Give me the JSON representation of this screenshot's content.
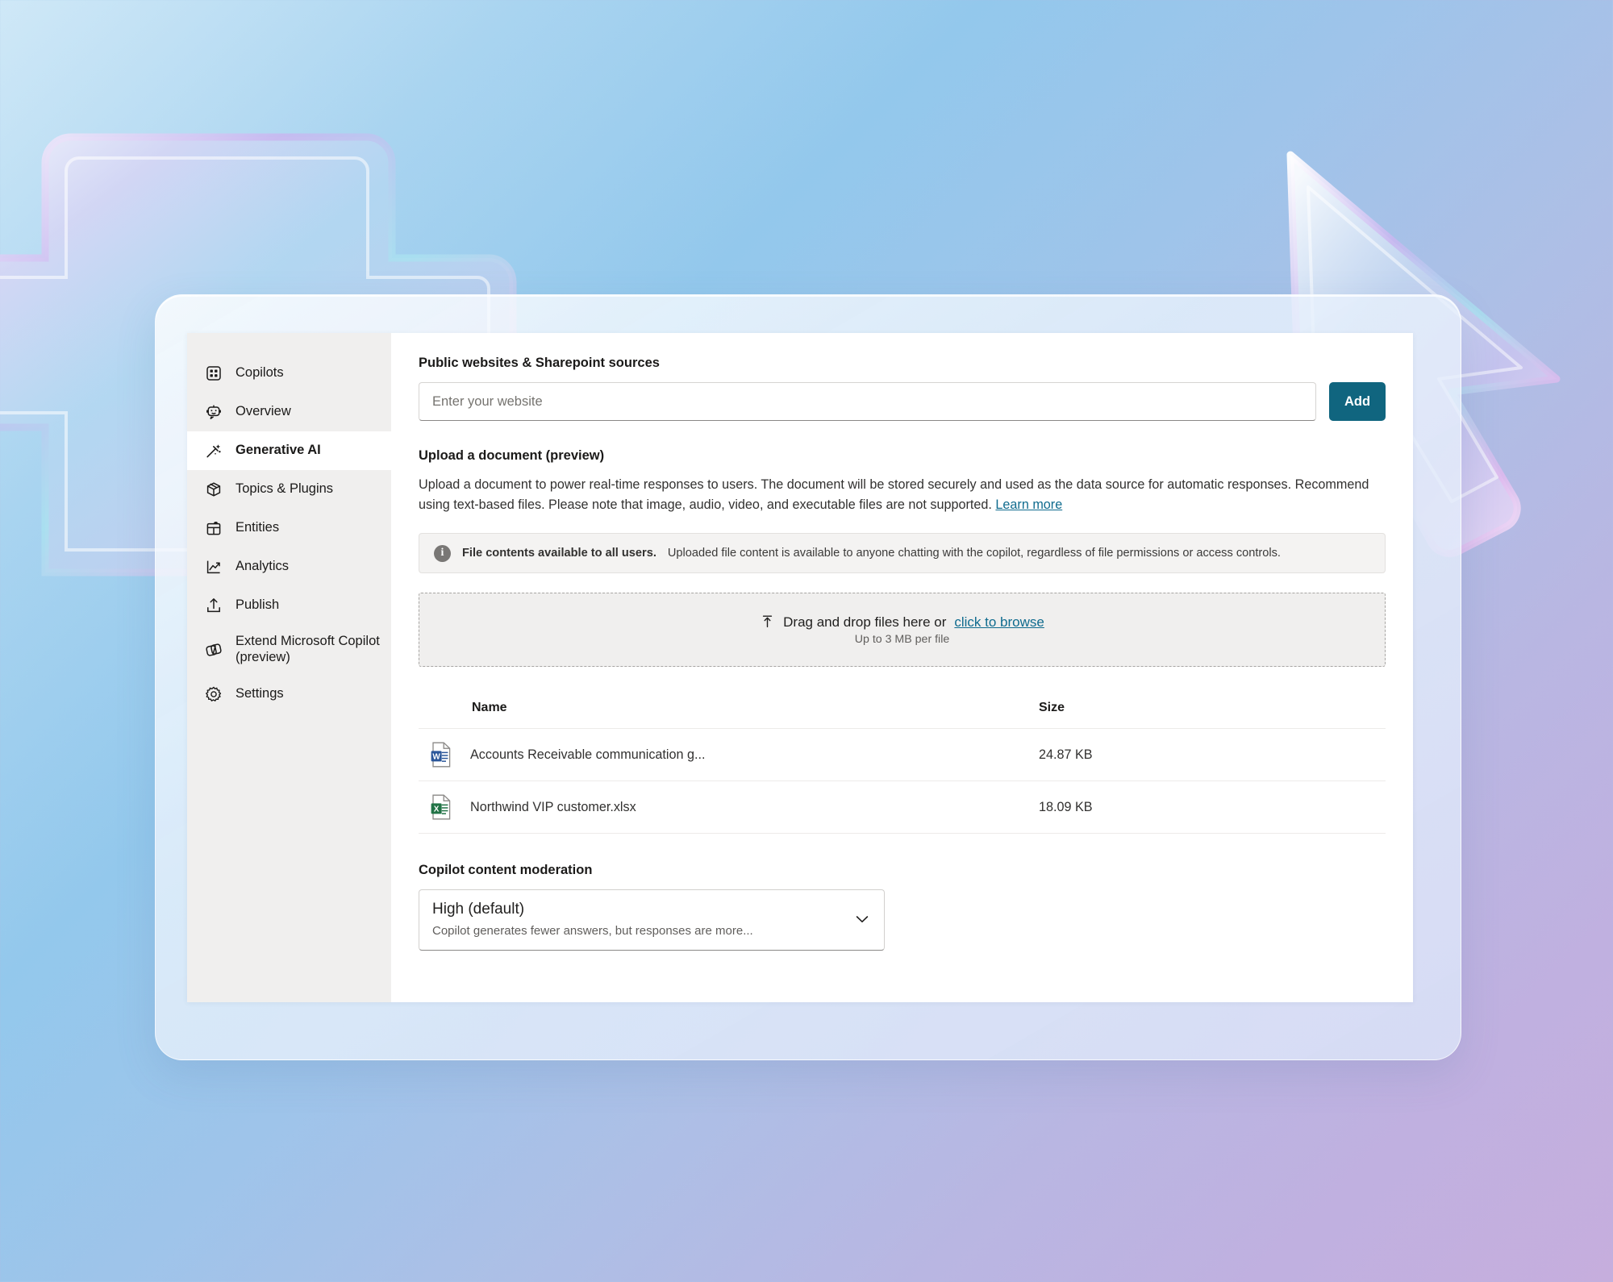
{
  "theme": {
    "accent_teal": "#10657f",
    "link_blue": "#0f6b8e",
    "sidebar_bg": "#f0efee",
    "word_blue": "#2b579a",
    "excel_green": "#217346",
    "background_from": "#cfe8f7",
    "background_to": "#c6aedd"
  },
  "sidebar": {
    "items": [
      {
        "label": "Copilots",
        "icon": "grid-apps-icon",
        "active": false
      },
      {
        "label": "Overview",
        "icon": "bot-icon",
        "active": false
      },
      {
        "label": "Generative AI",
        "icon": "magic-wand-icon",
        "active": true
      },
      {
        "label": "Topics & Plugins",
        "icon": "cube-icon",
        "active": false
      },
      {
        "label": "Entities",
        "icon": "entities-icon",
        "active": false
      },
      {
        "label": "Analytics",
        "icon": "chart-line-icon",
        "active": false
      },
      {
        "label": "Publish",
        "icon": "upload-arrow-icon",
        "active": false
      },
      {
        "label": "Extend Microsoft Copilot (preview)",
        "icon": "layers-icon",
        "active": false
      },
      {
        "label": "Settings",
        "icon": "gear-icon",
        "active": false
      }
    ]
  },
  "websites": {
    "title": "Public websites & Sharepoint sources",
    "input_placeholder": "Enter your website",
    "input_value": "",
    "add_label": "Add"
  },
  "upload": {
    "title": "Upload a document (preview)",
    "description": "Upload a document to power real-time responses to users. The document will be stored securely and used as the data source for automatic responses. Recommend using text-based files. Please note that image, audio, video, and executable files are not supported.",
    "learn_more": "Learn more",
    "banner": {
      "icon": "info-icon",
      "glyph": "i",
      "strong": "File contents available to all users.",
      "rest": "Uploaded file content is available to anyone chatting with the copilot, regardless of file permissions or access controls."
    },
    "dropzone": {
      "icon": "upload-arrow-icon",
      "text": "Drag and drop files here or",
      "browse_link": "click to browse",
      "sub": "Up to 3 MB per file"
    }
  },
  "file_table": {
    "columns": {
      "name": "Name",
      "size": "Size"
    },
    "rows": [
      {
        "icon": "word-document-icon",
        "name": "Accounts Receivable communication g...",
        "size": "24.87 KB"
      },
      {
        "icon": "excel-document-icon",
        "name": "Northwind VIP customer.xlsx",
        "size": "18.09 KB"
      }
    ]
  },
  "moderation": {
    "title": "Copilot content moderation",
    "selected_value": "High (default)",
    "selected_hint": "Copilot generates fewer answers, but responses are more...",
    "chevron_icon": "chevron-down-icon"
  }
}
